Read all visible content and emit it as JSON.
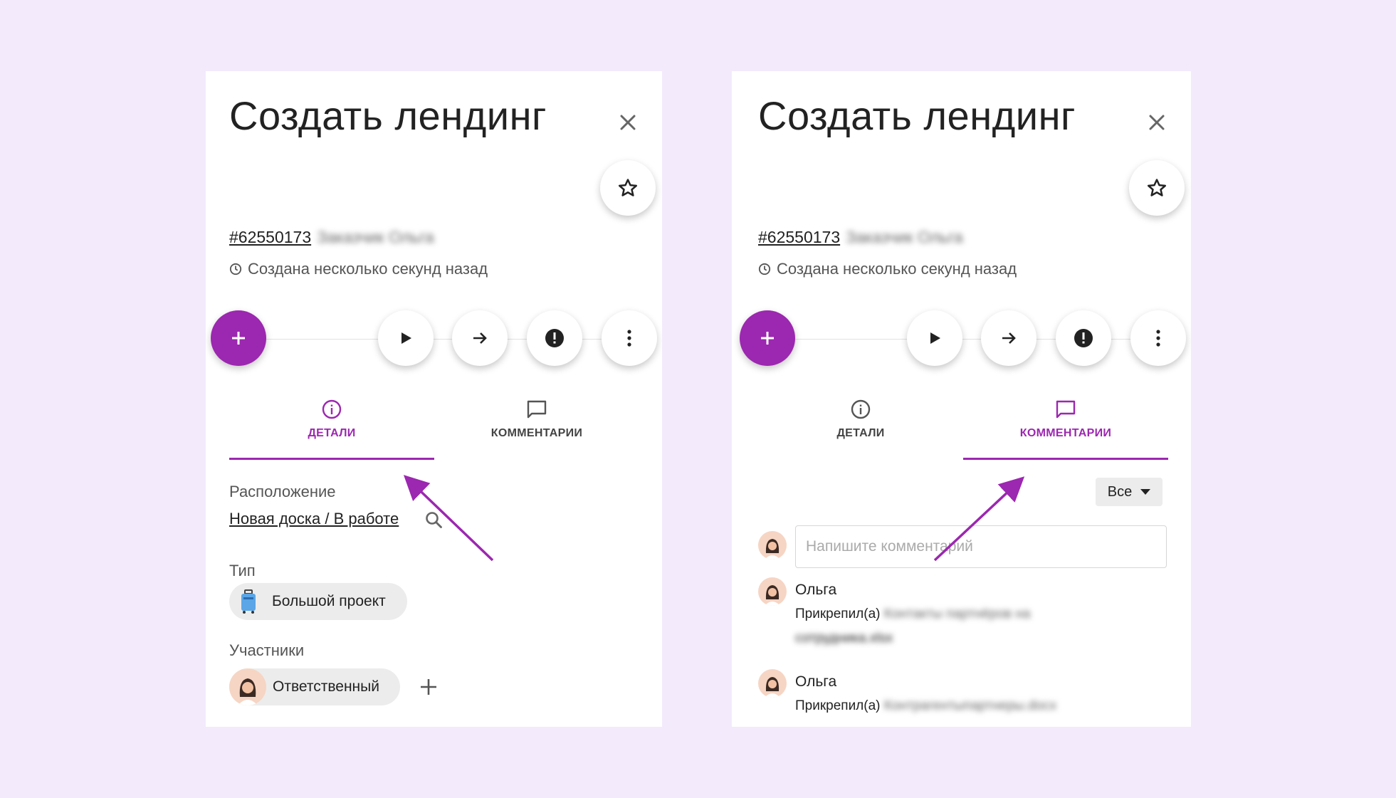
{
  "colors": {
    "accent": "#9c27b0",
    "background": "#f3eafc"
  },
  "left_panel": {
    "title": "Создать лендинг",
    "task_id": "#62550173",
    "task_author_blurred": "Заказчик Ольга",
    "created": "Создана несколько секунд назад",
    "tabs": [
      {
        "label": "ДЕТАЛИ",
        "icon": "info-icon",
        "active": true
      },
      {
        "label": "КОММЕНТАРИИ",
        "icon": "comment-icon",
        "active": false
      }
    ],
    "location_label": "Расположение",
    "location_value": "Новая доска / В работе",
    "type_label": "Тип",
    "type_value": "Большой проект",
    "participants_label": "Участники",
    "participant_role": "Ответственный"
  },
  "right_panel": {
    "title": "Создать лендинг",
    "task_id": "#62550173",
    "task_author_blurred": "Заказчик Ольга",
    "created": "Создана несколько секунд назад",
    "tabs": [
      {
        "label": "ДЕТАЛИ",
        "icon": "info-icon",
        "active": false
      },
      {
        "label": "КОММЕНТАРИИ",
        "icon": "comment-icon",
        "active": true
      }
    ],
    "filter_value": "Все",
    "comment_placeholder": "Напишите комментарий",
    "comments": [
      {
        "author": "Ольга",
        "action": "Прикрепил(а)",
        "file_blurred_1": "Контакты партнёров на",
        "file_blurred_2": "сотрудника.xlsx"
      },
      {
        "author": "Ольга",
        "action": "Прикрепил(а)",
        "file_blurred_1": "Контрагентыпартнеры.docx"
      }
    ]
  }
}
